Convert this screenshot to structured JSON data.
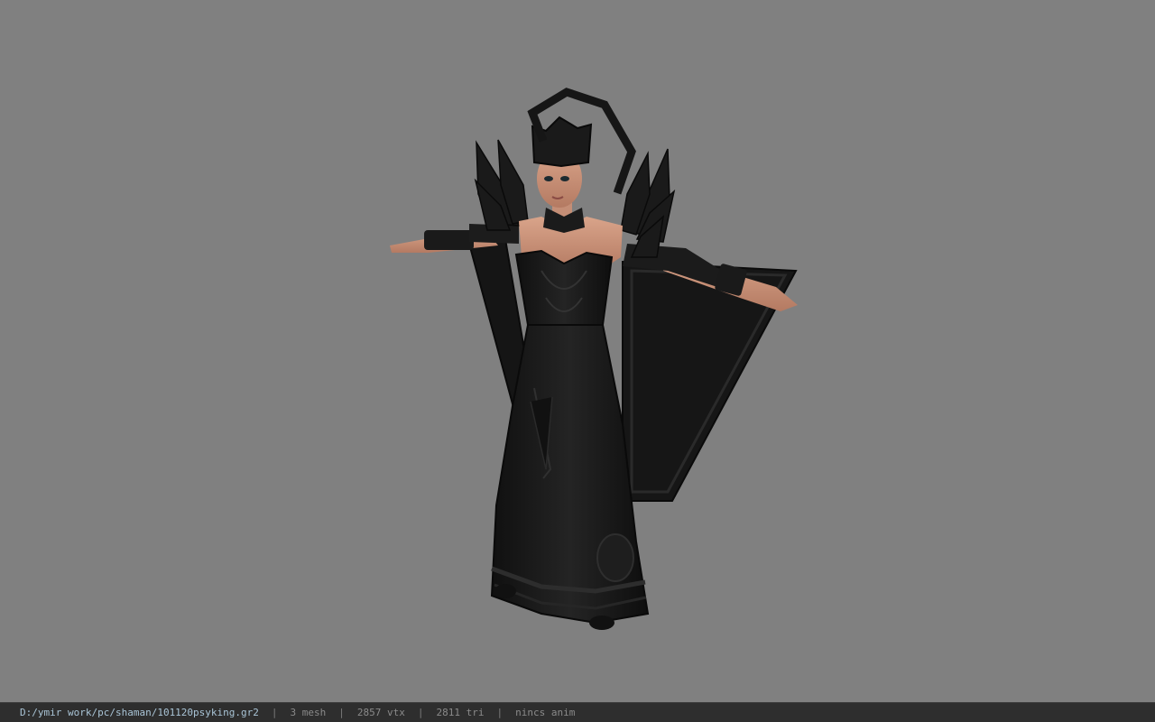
{
  "status_bar": {
    "file_path": "D:/ymir work/pc/shaman/101120psyking.gr2",
    "separator": "|",
    "mesh_count": "3 mesh",
    "vertex_count": "2857 vtx",
    "triangle_count": "2811 tri",
    "animation_info": "nincs anim"
  },
  "colors": {
    "viewport_background": "#808080",
    "status_bar_background": "#2e2e2e",
    "path_text": "#a9c4d6",
    "status_text": "#8a8a8a",
    "outfit": "#141414",
    "skin": "#c9937b"
  }
}
